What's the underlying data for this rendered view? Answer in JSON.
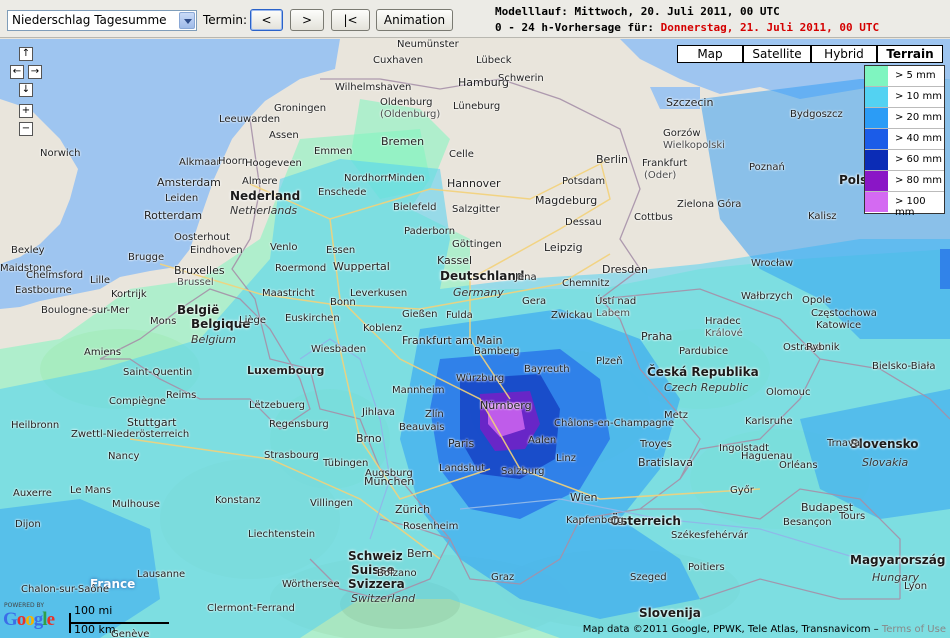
{
  "toolbar": {
    "product_select": "Niederschlag Tagesumme",
    "termin_label": "Termin:",
    "btn_prev": "<",
    "btn_next": ">",
    "btn_first": "|<",
    "btn_animation": "Animation",
    "run_line": "Modelllauf: Mittwoch, 20. Juli 2011, 00 UTC",
    "forecast_prefix": "0 - 24 h-Vorhersage für:",
    "forecast_date": "Donnerstag, 21. Juli 2011, 00 UTC"
  },
  "map_controls": {
    "up": "↑",
    "left": "←",
    "right": "→",
    "down": "↓",
    "zoom_in": "+",
    "zoom_out": "−"
  },
  "map_types": [
    "Map",
    "Satellite",
    "Hybrid",
    "Terrain"
  ],
  "selected_map_type": "Terrain",
  "legend": [
    {
      "label": "> 5 mm",
      "color": "#7ff5c0"
    },
    {
      "label": "> 10 mm",
      "color": "#53d2f2"
    },
    {
      "label": "> 20 mm",
      "color": "#2b9cf6"
    },
    {
      "label": "> 40 mm",
      "color": "#1b5ce8"
    },
    {
      "label": "> 60 mm",
      "color": "#0b2cb6"
    },
    {
      "label": "> 80 mm",
      "color": "#8a16c6"
    },
    {
      "label": "> 100 mm",
      "color": "#d46af2"
    }
  ],
  "colors": {
    "land": "#e9e5dc",
    "sea": "#9ec5f0",
    "forest": "#c8dcae",
    "mountain": "#d8cfc0"
  },
  "countries": [
    {
      "name": "Nederland",
      "sub": "Netherlands"
    },
    {
      "name": "België",
      "sub": "Belgique"
    },
    {
      "name": "Belgium",
      "sub": ""
    },
    {
      "name": "Luxembourg",
      "sub": ""
    },
    {
      "name": "Deutschland",
      "sub": "Germany"
    },
    {
      "name": "Česká Republika",
      "sub": "Czech Republic"
    },
    {
      "name": "France",
      "sub": ""
    },
    {
      "name": "Schweiz",
      "sub": "Suisse"
    },
    {
      "name": "Svizzera",
      "sub": "Switzerland"
    },
    {
      "name": "Österreich",
      "sub": ""
    },
    {
      "name": "Slovensko",
      "sub": "Slovakia"
    },
    {
      "name": "Magyarország",
      "sub": "Hungary"
    },
    {
      "name": "Slovenija",
      "sub": ""
    },
    {
      "name": "Pols",
      "sub": ""
    }
  ],
  "cities": [
    "Neumünster",
    "Lübeck",
    "Cuxhaven",
    "Hamburg",
    "Schwerin",
    "Szczecin",
    "Wilhelmshaven",
    "Oldenburg",
    "(Oldenburg)",
    "Lüneburg",
    "Bydgoszcz",
    "Leeuwarden",
    "Groningen",
    "Assen",
    "Bremen",
    "Emmen",
    "Celle",
    "Berlin",
    "Gorzów",
    "Wielkopolski",
    "Norwich",
    "Alkmaar",
    "Hoorn",
    "Hoogeveen",
    "Nordhorn",
    "Minden",
    "Hannover",
    "Frankfurt",
    "(Oder)",
    "Poznań",
    "Amsterdam",
    "Almere",
    "Enschede",
    "Bielefeld",
    "Salzgitter",
    "Potsdam",
    "Magdeburg",
    "Zielona Góra",
    "Leiden",
    "Rotterdam",
    "Oosterhout",
    "Eindhoven",
    "Venlo",
    "Paderborn",
    "Dessau",
    "Cottbus",
    "Kalisz",
    "Bexley",
    "Maidstone",
    "Brugge",
    "Bruxelles",
    "Brussel",
    "Essen",
    "Göttingen",
    "Leipzig",
    "Chelmsford",
    "Eastbourne",
    "Kortrijk",
    "Roermond",
    "Wuppertal",
    "Kassel",
    "Dresden",
    "Wrocław",
    "Boulogne-sur-Mer",
    "Mons",
    "Maastricht",
    "Leverkusen",
    "Bonn",
    "Jena",
    "Chemnitz",
    "Ústí nad",
    "Labem",
    "Wałbrzych",
    "Opole",
    "Lille",
    "Liège",
    "Euskirchen",
    "Gießen",
    "Fulda",
    "Gera",
    "Zwickau",
    "Hradec",
    "Králové",
    "Częstochowa",
    "Koblenz",
    "Praha",
    "Katowice",
    "Amiens",
    "Wiesbaden",
    "Frankfurt am Main",
    "Bamberg",
    "Plzeň",
    "Bayreuth",
    "Pardubice",
    "Ostrava",
    "Rybnik",
    "Bielsko-Biała",
    "Saint-Quentin",
    "Mannheim",
    "Würzburg",
    "Olomouc",
    "Compiègne",
    "Reims",
    "Lëtzebuerg",
    "Nürnberg",
    "Jihlava",
    "Zlín",
    "Beauvais",
    "Châlons-en-Champagne",
    "Metz",
    "Karlsruhe",
    "Heilbronn",
    "Stuttgart",
    "Regensburg",
    "Brno",
    "Paris",
    "Aalen",
    "Ingolstadt",
    "Trnava",
    "Haguenau",
    "Zwettl-Niederösterreich",
    "Troyes",
    "Nancy",
    "Strasbourg",
    "Tübingen",
    "Augsburg",
    "Landshut",
    "Linz",
    "Bratislava",
    "Orléans",
    "Le Mans",
    "Auxerre",
    "Mulhouse",
    "Villingen",
    "München",
    "Salzburg",
    "Wien",
    "Győr",
    "Budapest",
    "Tours",
    "Dijon",
    "Konstanz",
    "Zürich",
    "Rosenheim",
    "Kapfenberg",
    "Székesfehérvár",
    "Besançon",
    "Liechtenstein",
    "Bern",
    "Bolzano",
    "Graz",
    "Poitiers",
    "Chalon-sur-Saône",
    "Lausanne",
    "Wörthersee",
    "Szeged",
    "Lyon",
    "Clermont-Ferrand",
    "Genève"
  ],
  "scale": {
    "mi": "100 mi",
    "km": "100 km"
  },
  "powered_by": "POWERED BY",
  "google": "Google",
  "copyright": "Map data ©2011 Google, PPWK, Tele Atlas, Transnavicom –",
  "terms": "Terms of Use"
}
